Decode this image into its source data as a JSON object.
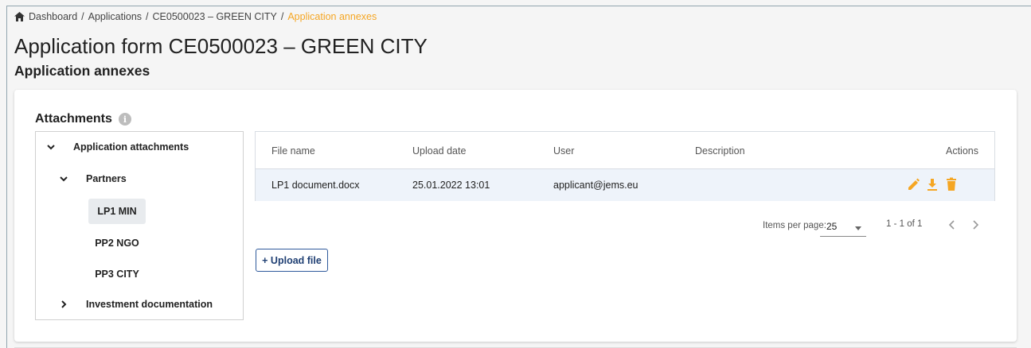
{
  "breadcrumb": {
    "items": [
      "Dashboard",
      "Applications",
      "CE0500023 – GREEN CITY"
    ],
    "active": "Application annexes",
    "separator": "/"
  },
  "page": {
    "title": "Application form CE0500023 – GREEN CITY",
    "subtitle": "Application annexes"
  },
  "card": {
    "title": "Attachments",
    "info_icon": "i"
  },
  "tree": {
    "root": "Application attachments",
    "partners": "Partners",
    "leaves": [
      "LP1 MIN",
      "PP2 NGO",
      "PP3 CITY"
    ],
    "selected_leaf": "LP1 MIN",
    "investment": "Investment documentation"
  },
  "table": {
    "headers": {
      "file_name": "File name",
      "upload_date": "Upload date",
      "user": "User",
      "description": "Description",
      "actions": "Actions"
    },
    "rows": [
      {
        "file_name": "LP1 document.docx",
        "upload_date": "25.01.2022 13:01",
        "user": "applicant@jems.eu",
        "description": ""
      }
    ]
  },
  "paginator": {
    "items_per_page_label": "Items per page:",
    "page_size": "25",
    "range": "1 - 1 of 1"
  },
  "upload_button": "+ Upload file",
  "colors": {
    "accent": "#f5a623",
    "primary_button": "#1f3f73",
    "row_highlight": "#eef3fa",
    "selected_leaf": "#e8ebee"
  },
  "icons": {
    "home": "home-icon",
    "info": "info-icon",
    "expand": "chevron-down-icon",
    "collapse": "chevron-right-icon",
    "edit": "pencil-icon",
    "download": "download-icon",
    "delete": "trash-icon",
    "prev": "chevron-left-icon",
    "next": "chevron-right-icon"
  }
}
